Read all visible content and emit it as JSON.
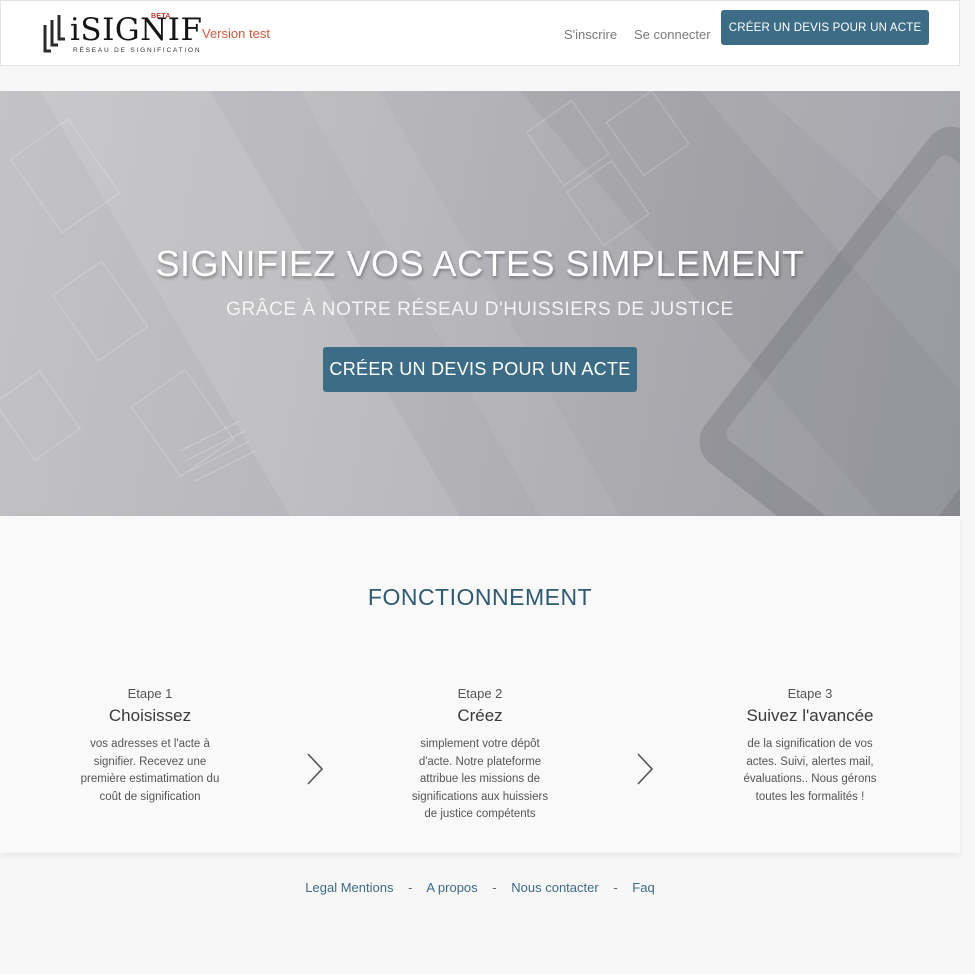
{
  "header": {
    "logo": {
      "name": "iSIGNIF",
      "badge": "BETA",
      "tagline": "RÉSEAU DE SIGNIFICATION"
    },
    "version_label": "Version test",
    "signup_label": "S'inscrire",
    "login_label": "Se connecter",
    "cta_label": "CRÉER UN DEVIS POUR UN ACTE"
  },
  "hero": {
    "title": "SIGNIFIEZ VOS ACTES SIMPLEMENT",
    "subtitle": "GRÂCE À NOTRE RÉSEAU D'HUISSIERS DE JUSTICE",
    "cta_label": "CRÉER UN DEVIS POUR UN ACTE"
  },
  "how_it_works": {
    "title": "FONCTIONNEMENT",
    "steps": [
      {
        "label": "Etape 1",
        "title": "Choisissez",
        "description": "vos adresses et l'acte à signifier. Recevez une première estimatimation du coût de signification"
      },
      {
        "label": "Etape 2",
        "title": "Créez",
        "description": "simplement votre dépôt d'acte. Notre plateforme attribue les missions de significations aux huissiers de justice compétents"
      },
      {
        "label": "Etape 3",
        "title": "Suivez l'avancée",
        "description": "de la signification de vos actes. Suivi, alertes mail, évaluations.. Nous gérons toutes les formalités !"
      }
    ],
    "separator_icon": "chevron-right-icon"
  },
  "footer": {
    "links": [
      "Legal Mentions",
      "A propos",
      "Nous contacter",
      "Faq"
    ],
    "separator": "-"
  },
  "colors": {
    "accent": "#3d6c86",
    "title": "#2f5a73",
    "version": "#d05a3a",
    "beta": "#c0392b"
  }
}
